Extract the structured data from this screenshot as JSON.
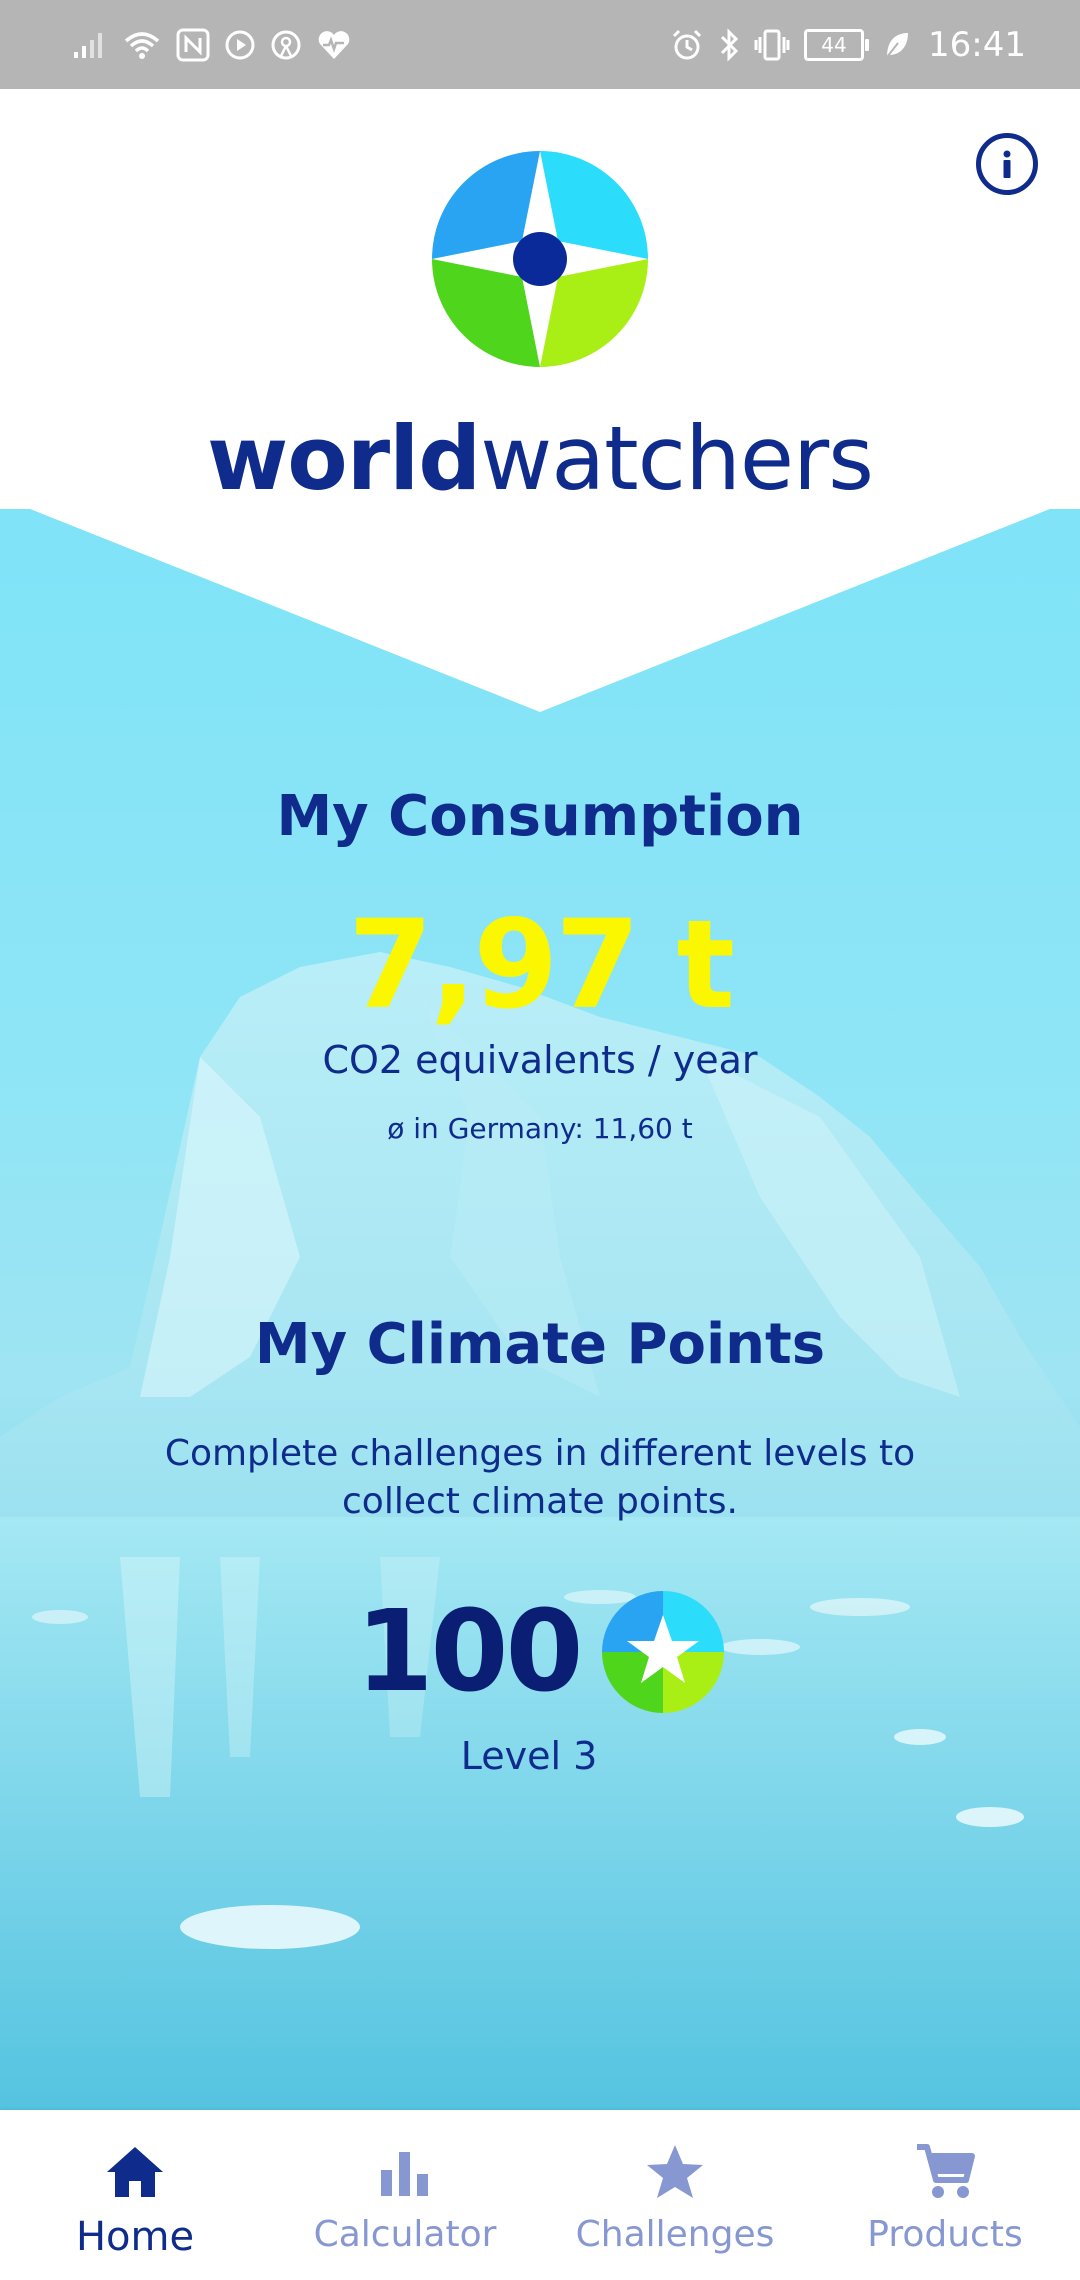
{
  "status_bar": {
    "time": "16:41",
    "battery": "44",
    "left_icons": [
      "signal-icon",
      "wifi-icon",
      "nfc-icon",
      "media-icon",
      "hotspot-icon",
      "health-icon"
    ],
    "right_icons": [
      "alarm-icon",
      "bluetooth-icon",
      "vibrate-icon",
      "battery-icon",
      "leaf-icon"
    ]
  },
  "header": {
    "brand_bold": "world",
    "brand_light": "watchers"
  },
  "consumption": {
    "title": "My Consumption",
    "value": "7,97 t",
    "unit": "CO2 equivalents / year",
    "average": "ø in Germany: 11,60 t"
  },
  "climate_points": {
    "title": "My Climate Points",
    "description": "Complete challenges in different levels to collect climate points.",
    "value": "100",
    "level": "Level 3"
  },
  "nav": {
    "items": [
      {
        "label": "Home",
        "icon": "home-icon",
        "active": true
      },
      {
        "label": "Calculator",
        "icon": "bar-chart-icon",
        "active": false
      },
      {
        "label": "Challenges",
        "icon": "star-icon",
        "active": false
      },
      {
        "label": "Products",
        "icon": "cart-icon",
        "active": false
      }
    ]
  },
  "colors": {
    "brand_blue": "#0f2c8c",
    "highlight_yellow": "#fbf700",
    "nav_inactive": "#8797d1",
    "status_bar": "#b5b5b5",
    "hero_cyan": "#7fe3f7"
  }
}
